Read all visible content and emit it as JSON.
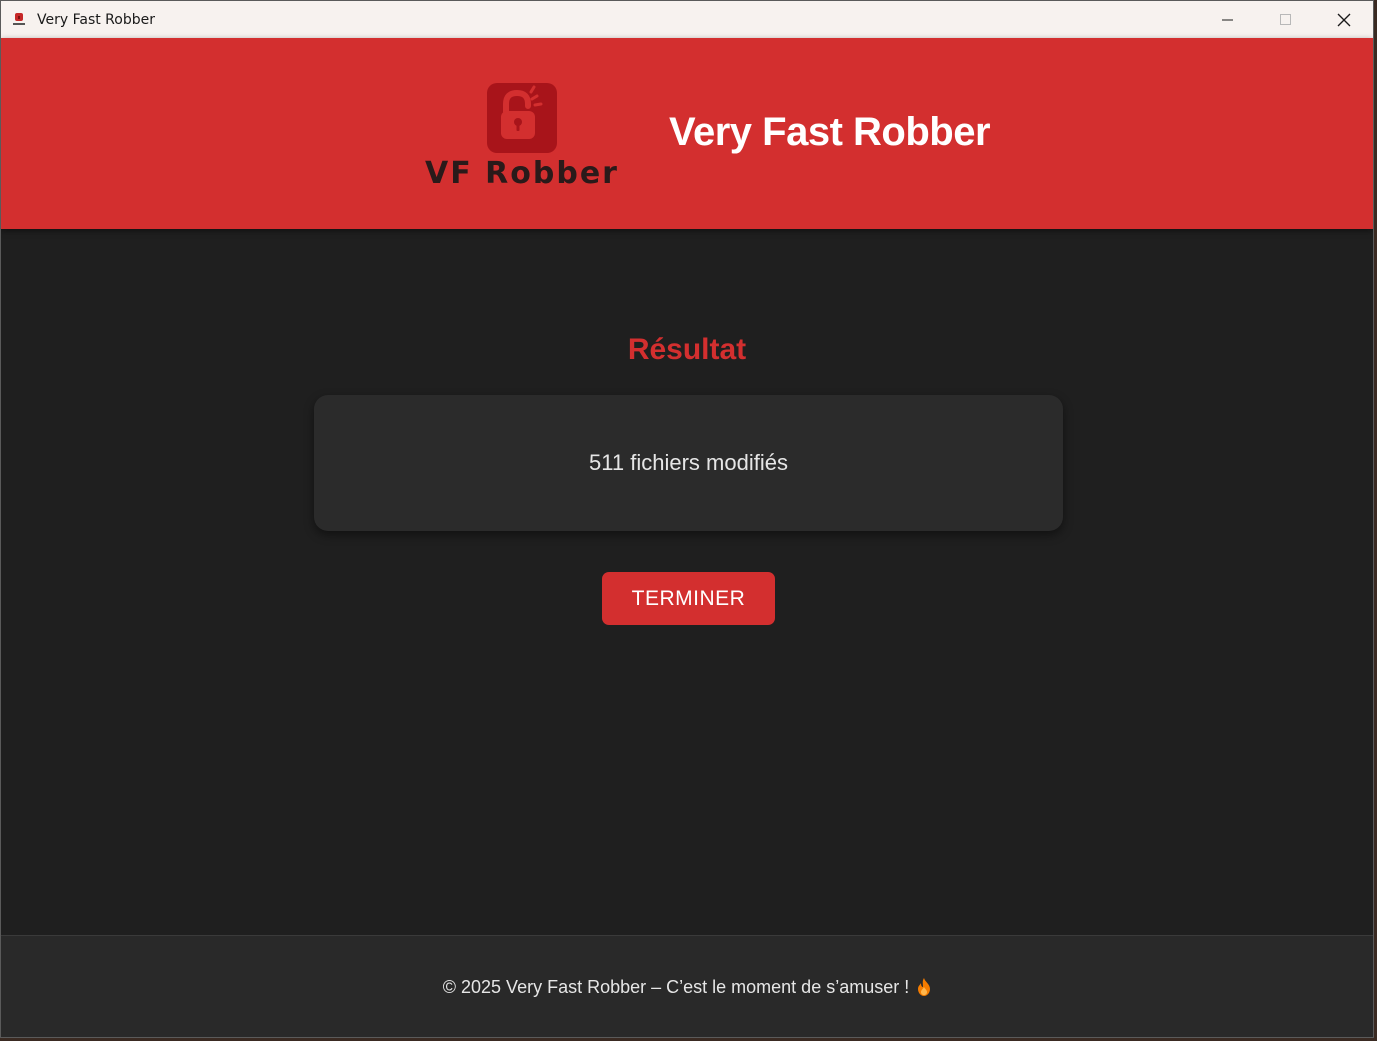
{
  "window": {
    "title": "Very Fast Robber"
  },
  "header": {
    "logo_text": "VF Robber",
    "title": "Very Fast Robber",
    "accent_color": "#d32f2f"
  },
  "main": {
    "heading": "Résultat",
    "result_text": "511 fichiers modifiés",
    "finish_label": "TERMINER"
  },
  "footer": {
    "text": "© 2025 Very Fast Robber – C’est le moment de s’amuser !",
    "icon": "fire-icon"
  }
}
